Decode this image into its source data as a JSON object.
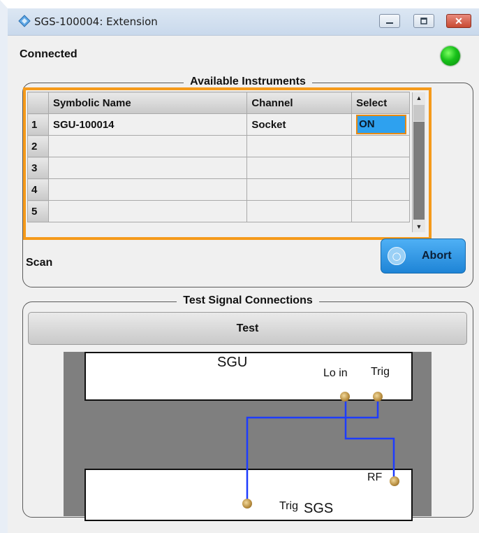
{
  "window": {
    "title": "SGS-100004: Extension",
    "close_glyph": "✕"
  },
  "status": {
    "label": "Connected",
    "led_color": "#18c11a"
  },
  "available_instruments": {
    "title": "Available Instruments",
    "columns": [
      "Symbolic Name",
      "Channel",
      "Select"
    ],
    "rows": [
      {
        "num": "1",
        "name": "SGU-100014",
        "channel": "Socket",
        "select": "ON"
      },
      {
        "num": "2",
        "name": "",
        "channel": "",
        "select": ""
      },
      {
        "num": "3",
        "name": "",
        "channel": "",
        "select": ""
      },
      {
        "num": "4",
        "name": "",
        "channel": "",
        "select": ""
      },
      {
        "num": "5",
        "name": "",
        "channel": "",
        "select": ""
      }
    ],
    "scan_label": "Scan",
    "abort_label": "Abort"
  },
  "test_signal": {
    "title": "Test Signal Connections",
    "test_label": "Test",
    "diagram": {
      "sgu_label": "SGU",
      "sgs_label": "SGS",
      "lo_in_label": "Lo in",
      "trig_top_label": "Trig",
      "rf_label": "RF",
      "trig_bottom_label": "Trig",
      "wire_color": "#1e3cff"
    }
  },
  "colors": {
    "accent_orange": "#f59a1b",
    "select_blue": "#2ea1ef",
    "abort_blue": "#1e84d6"
  }
}
